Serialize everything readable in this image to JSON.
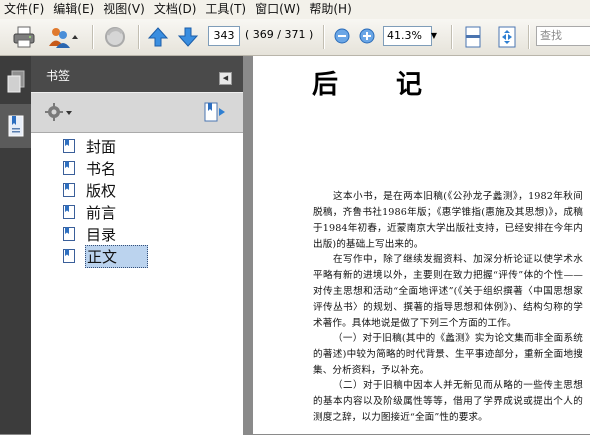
{
  "menu": [
    {
      "label": "文件(F)"
    },
    {
      "label": "编辑(E)"
    },
    {
      "label": "视图(V)"
    },
    {
      "label": "文档(D)"
    },
    {
      "label": "工具(T)"
    },
    {
      "label": "窗口(W)"
    },
    {
      "label": "帮助(H)"
    }
  ],
  "toolbar": {
    "page_current": "343",
    "page_count": "( 369 / 371 )",
    "zoom": "41.3%",
    "search_placeholder": "查找"
  },
  "panel": {
    "title": "书签",
    "bookmarks": [
      {
        "label": "封面"
      },
      {
        "label": "书名"
      },
      {
        "label": "版权"
      },
      {
        "label": "前言"
      },
      {
        "label": "目录"
      },
      {
        "label": "正文"
      }
    ],
    "selected": "正文"
  },
  "document": {
    "title_left": "后",
    "title_right": "记",
    "paragraphs": [
      "这本小书，是在两本旧稿(《公孙龙子蠡测》，1982年秋间脱稿，齐鲁书社1986年版；《惠学锥指(惠施及其思想)》，成稿于1984年初春，近蒙南京大学出版社支持，已经安排在今年内出版)的基础上写出来的。",
      "在写作中，除了继续发掘资料、加深分析论证以使学术水平略有新的进境以外，主要则在致力把握“评传”体的个性——对传主思想和活动“全面地评述”(《关于组织撰著〈中国思想家评传丛书〉的规划、撰著的指导思想和体例》)、结构匀称的学术著作。具体地说是做了下列三个方面的工作。",
      "（一）对于旧稿(其中的《蠡测》实为论文集而非全面系统的著述)中较为简略的时代背景、生平事迹部分，重新全面地搜集、分析资料，予以补充。",
      "（二）对于旧稿中因本人并无新见而从略的一些传主思想的基本内容以及阶级属性等等，借用了学界成说或提出个人的测度之辞，以力图接近“全面”性的要求。"
    ]
  },
  "colors": {
    "chrome": "#f3f1ea",
    "nav_rail": "#3c3c3c",
    "panel_header": "#4a4a4a",
    "selection": "#bbd3ee",
    "arrow_blue": "#2e7fd2"
  }
}
